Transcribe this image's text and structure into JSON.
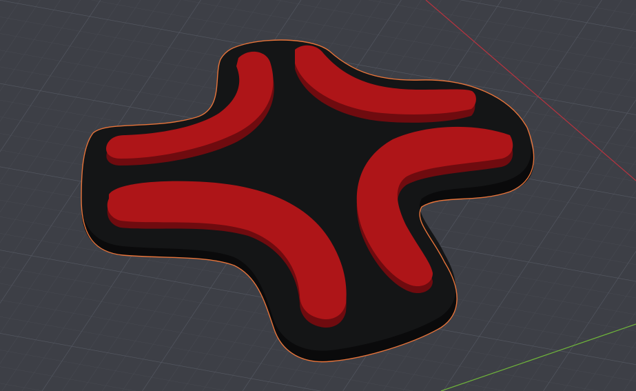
{
  "viewport": {
    "background_color": "#3d3f46",
    "grid_minor_color": "#4a4d55",
    "grid_major_color": "#555963",
    "x_axis_color": "#b8333f",
    "y_axis_color": "#6fb53a"
  },
  "object": {
    "selected": true,
    "selection_outline_color": "#e8743a",
    "base_top_color": "#141516",
    "base_side_color": "#0a0a0b",
    "arc_top_color": "#ae1518",
    "arc_side_color": "#6f0b0f",
    "arcs": [
      "top-left",
      "top-right",
      "bottom-left",
      "bottom-right"
    ]
  }
}
